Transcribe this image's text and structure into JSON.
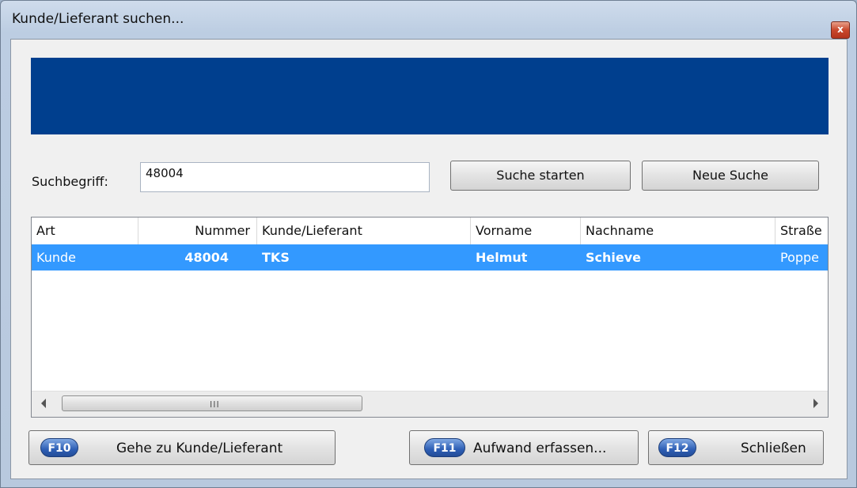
{
  "window": {
    "title": "Kunde/Lieferant suchen...",
    "close_glyph": "x"
  },
  "search": {
    "label": "Suchbegriff:",
    "value": "48004",
    "placeholder": ""
  },
  "buttons": {
    "start": "Suche starten",
    "new": "Neue Suche"
  },
  "table": {
    "columns": [
      "Art",
      "Nummer",
      "Kunde/Lieferant",
      "Vorname",
      "Nachname",
      "Straße"
    ],
    "rows": [
      {
        "art": "Kunde",
        "nummer": "48004",
        "kunde": "TKS",
        "vorname": "Helmut",
        "nachname": "Schieve",
        "strasse": "Poppe"
      }
    ],
    "scroll_grip": "III"
  },
  "footer": {
    "goto": {
      "key": "F10",
      "label": "Gehe zu Kunde/Lieferant"
    },
    "effort": {
      "key": "F11",
      "label": "Aufwand erfassen..."
    },
    "close": {
      "key": "F12",
      "label": "Schließen"
    }
  },
  "colors": {
    "banner": "#003f8e",
    "selection": "#3399ff",
    "key_badge": "#2e5fb5"
  }
}
